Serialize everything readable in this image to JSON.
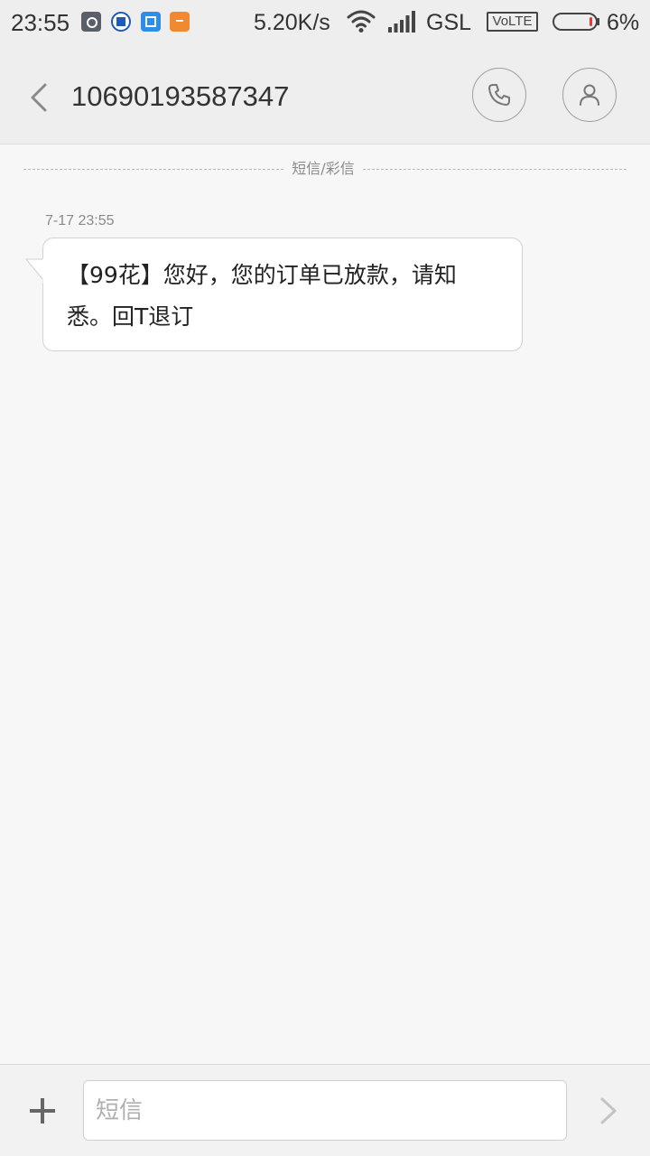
{
  "status_bar": {
    "time": "23:55",
    "net_speed": "5.20K/s",
    "carrier": "GSL",
    "volte": "VoLTE",
    "battery_percent": "6%",
    "battery_level": 0.06,
    "notification_icons": [
      "settings-app-icon",
      "bank-app-icon",
      "taobao-app-icon",
      "shopping-bag-app-icon"
    ]
  },
  "header": {
    "title": "10690193587347",
    "back_icon": "chevron-left-icon",
    "call_icon": "phone-icon",
    "contact_icon": "person-icon"
  },
  "thread": {
    "channel_label": "短信/彩信",
    "messages": [
      {
        "timestamp": "7-17 23:55",
        "line1": "【99花】您好，您的订单已放款，请知",
        "line2": "悉。回T退订"
      }
    ]
  },
  "composer": {
    "placeholder": "短信",
    "value": "",
    "add_icon": "plus-icon",
    "send_icon": "chevron-right-icon"
  },
  "colors": {
    "background": "#f7f7f7",
    "bar": "#eeeeee",
    "bubble": "#ffffff",
    "text": "#333333",
    "muted": "#8a8a8a",
    "battery_low": "#e53935"
  }
}
